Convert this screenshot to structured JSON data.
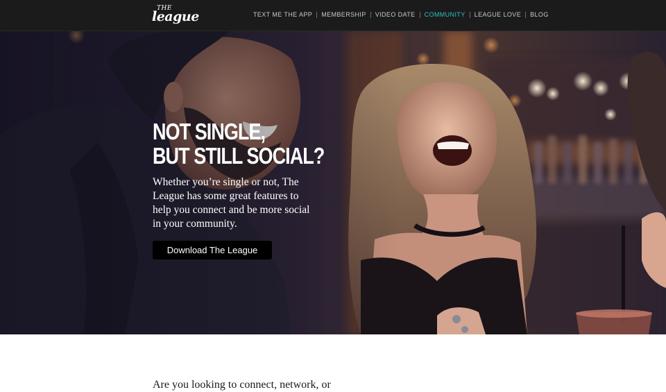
{
  "header": {
    "logo_the": "THE",
    "logo_league": "league",
    "nav": [
      {
        "label": "TEXT ME THE APP",
        "active": false
      },
      {
        "label": "MEMBERSHIP",
        "active": false
      },
      {
        "label": "VIDEO DATE",
        "active": false
      },
      {
        "label": "COMMUNITY",
        "active": true
      },
      {
        "label": "LEAGUE LOVE",
        "active": false
      },
      {
        "label": "BLOG",
        "active": false
      }
    ]
  },
  "hero": {
    "title_line1": "NOT SINGLE,",
    "title_line2": "BUT STILL SOCIAL?",
    "body": "Whether you’re single or not, The League has some great features to help you connect and be more social in your community.",
    "button_label": "Download The League",
    "image": "photo-of-laughing-man-and-woman-at-bar"
  },
  "content": {
    "intro": "Are you looking to connect, network, or"
  },
  "colors": {
    "nav_bg": "#1b1b1b",
    "nav_text": "#c9c9c9",
    "nav_active": "#2fc2c2",
    "button_bg": "#000000"
  }
}
